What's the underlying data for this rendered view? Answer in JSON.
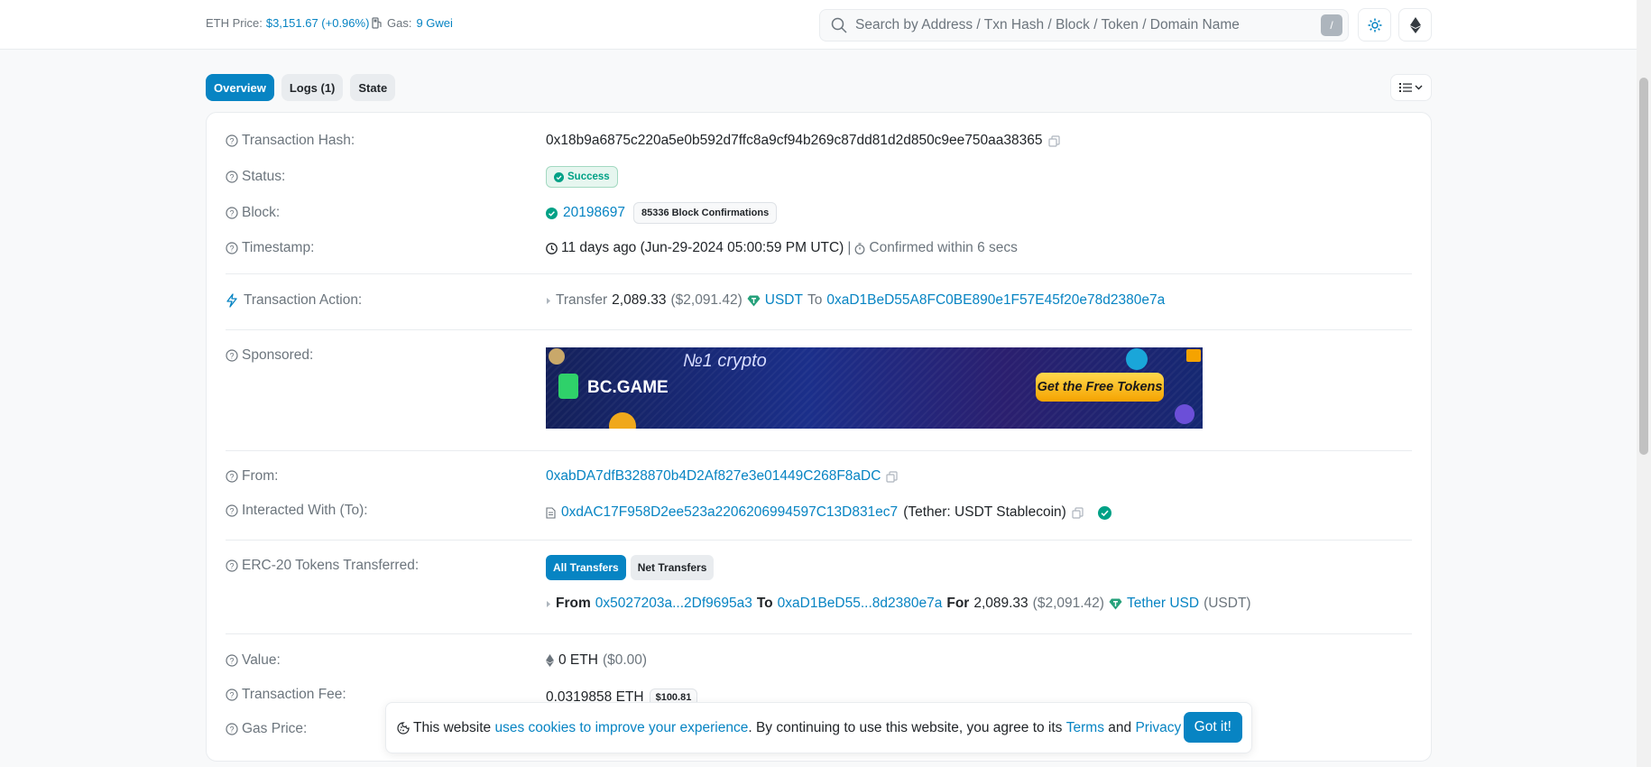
{
  "header": {
    "eth_price_label": "ETH Price:",
    "eth_price_value": "$3,151.67 (+0.96%)",
    "gas_label": "Gas:",
    "gas_value": "9 Gwei",
    "search_placeholder": "Search by Address / Txn Hash / Block / Token / Domain Name",
    "search_shortcut": "/"
  },
  "tabs": [
    {
      "label": "Overview",
      "active": true
    },
    {
      "label": "Logs (1)",
      "active": false
    },
    {
      "label": "State",
      "active": false
    }
  ],
  "details": {
    "tx_hash_label": "Transaction Hash:",
    "tx_hash": "0x18b9a6875c220a5e0b592d7ffc8a9cf94b269c87dd81d2d850c9ee750aa38365",
    "status_label": "Status:",
    "status": "Success",
    "block_label": "Block:",
    "block": "20198697",
    "block_confirmations": "85336 Block Confirmations",
    "timestamp_label": "Timestamp:",
    "timestamp": "11 days ago (Jun-29-2024 05:00:59 PM UTC)",
    "timestamp_sep": "|",
    "confirmed_within": "Confirmed within 6 secs",
    "action_label": "Transaction Action:",
    "action_verb": "Transfer",
    "action_amount": "2,089.33",
    "action_usd": "($2,091.42)",
    "action_token": "USDT",
    "action_to_word": "To",
    "action_to": "0xaD1BeD55A8FC0BE890e1F57E45f20e78d2380e7a",
    "sponsored_label": "Sponsored:",
    "from_label": "From:",
    "from": "0xabDA7dfB328870b4D2Af827e3e01449C268F8aDC",
    "to_label": "Interacted With (To):",
    "to": "0xdAC17F958D2ee523a2206206994597C13D831ec7",
    "to_name": "(Tether: USDT Stablecoin)",
    "erc20_label": "ERC-20 Tokens Transferred:",
    "erc20_all": "All Transfers",
    "erc20_net": "Net Transfers",
    "erc20_from_word": "From",
    "erc20_from": "0x5027203a...2Df9695a3",
    "erc20_to_word": "To",
    "erc20_to": "0xaD1BeD55...8d2380e7a",
    "erc20_for_word": "For",
    "erc20_amount": "2,089.33",
    "erc20_usd": "($2,091.42)",
    "erc20_token": "Tether USD",
    "erc20_symbol": "(USDT)",
    "value_label": "Value:",
    "value": "0 ETH",
    "value_usd": "($0.00)",
    "fee_label": "Transaction Fee:",
    "fee": "0.0319858 ETH",
    "fee_usd": "$100.81",
    "gas_price_label": "Gas Price:"
  },
  "banner": {
    "brand": "BC.GAME",
    "tagline": "№1 crypto",
    "cta": "Get the Free Tokens"
  },
  "cookie": {
    "text_1": "This website",
    "link_1": "uses cookies to improve your experience",
    "text_2": ". By continuing to use this website, you agree to its",
    "link_terms": "Terms",
    "text_and": "and",
    "link_privacy": "Privacy Policy",
    "text_end": ".",
    "button": "Got it!"
  },
  "colors": {
    "primary": "#0784c3",
    "success": "#00a186"
  }
}
